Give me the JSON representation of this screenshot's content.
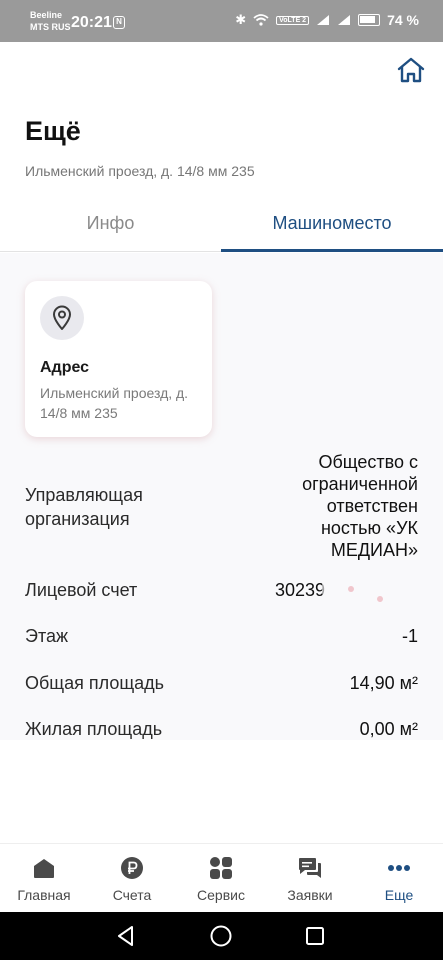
{
  "status_bar": {
    "carrier_line1": "Beeline",
    "carrier_line2": "MTS RUS",
    "time": "20:21",
    "nfc": "N",
    "signal_label": "VoLTE 2",
    "battery": "74 %"
  },
  "header": {
    "title": "Ещё",
    "subtitle": "Ильменский проезд, д. 14/8 мм 235"
  },
  "tabs": [
    {
      "label": "Инфо",
      "active": false
    },
    {
      "label": "Машиноместо",
      "active": true
    }
  ],
  "address_card": {
    "title": "Адрес",
    "text": "Ильменский проезд, д. 14/8 мм 235",
    "icon": "location-pin-icon"
  },
  "details": {
    "org_label": "Управляющая организация",
    "org_value": "Общество с ограниченной ответствен ностью «УК МЕДИАН»",
    "account_label": "Лицевой счет",
    "account_value": "30239",
    "floor_label": "Этаж",
    "floor_value": "-1",
    "total_area_label": "Общая площадь",
    "total_area_value": "14,90 м²",
    "living_area_label": "Жилая площадь",
    "living_area_value": "0,00 м²"
  },
  "bottom_nav": [
    {
      "label": "Главная",
      "icon": "home-icon"
    },
    {
      "label": "Счета",
      "icon": "ruble-icon"
    },
    {
      "label": "Сервис",
      "icon": "grid-icon"
    },
    {
      "label": "Заявки",
      "icon": "chat-icon"
    },
    {
      "label": "Еще",
      "icon": "more-dots-icon",
      "active": true
    }
  ],
  "colors": {
    "accent": "#1f4f82",
    "status_bar": "#9a9a9a"
  }
}
